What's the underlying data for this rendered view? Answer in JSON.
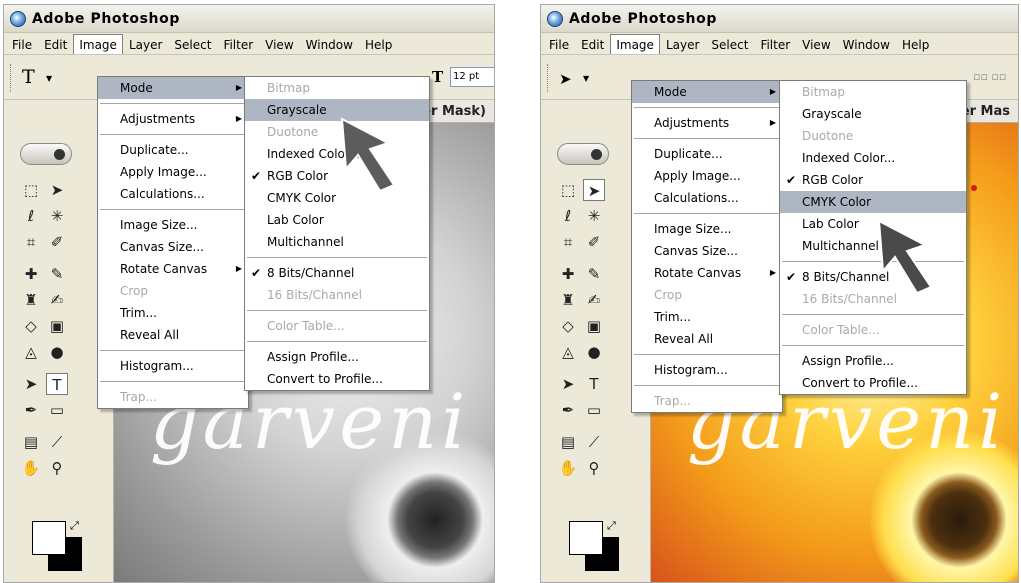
{
  "app_title": "Adobe Photoshop",
  "menubar": [
    "File",
    "Edit",
    "Image",
    "Layer",
    "Select",
    "Filter",
    "View",
    "Window",
    "Help"
  ],
  "image_menu": [
    {
      "label": "Mode",
      "submenu": true
    },
    {
      "label": "Adjustments",
      "submenu": true
    },
    {
      "label": "Duplicate..."
    },
    {
      "label": "Apply Image..."
    },
    {
      "label": "Calculations..."
    },
    {
      "label": "Image Size..."
    },
    {
      "label": "Canvas Size..."
    },
    {
      "label": "Rotate Canvas",
      "submenu": true
    },
    {
      "label": "Crop",
      "disabled": true
    },
    {
      "label": "Trim..."
    },
    {
      "label": "Reveal All"
    },
    {
      "label": "Histogram..."
    },
    {
      "label": "Trap...",
      "disabled": true
    }
  ],
  "mode_submenu": [
    {
      "label": "Bitmap",
      "disabled": true
    },
    {
      "label": "Grayscale"
    },
    {
      "label": "Duotone",
      "disabled": true
    },
    {
      "label": "Indexed Color..."
    },
    {
      "label": "RGB Color",
      "checked": true
    },
    {
      "label": "CMYK Color"
    },
    {
      "label": "Lab Color"
    },
    {
      "label": "Multichannel"
    },
    {
      "label": "8 Bits/Channel",
      "checked": true
    },
    {
      "label": "16 Bits/Channel",
      "disabled": true
    },
    {
      "label": "Color Table...",
      "disabled": true
    },
    {
      "label": "Assign Profile..."
    },
    {
      "label": "Convert to Profile..."
    }
  ],
  "panels": [
    {
      "canvas_title": "er Mask)",
      "script_text": "garveni",
      "font_size": "12 pt",
      "highlighted_mode": "Grayscale"
    },
    {
      "canvas_title": "er Mas",
      "script_text": "garveni",
      "highlighted_mode": "CMYK Color"
    }
  ],
  "colors": {
    "menu_highlight": "#aeb6c3",
    "disabled_text": "#a9a9a9"
  }
}
